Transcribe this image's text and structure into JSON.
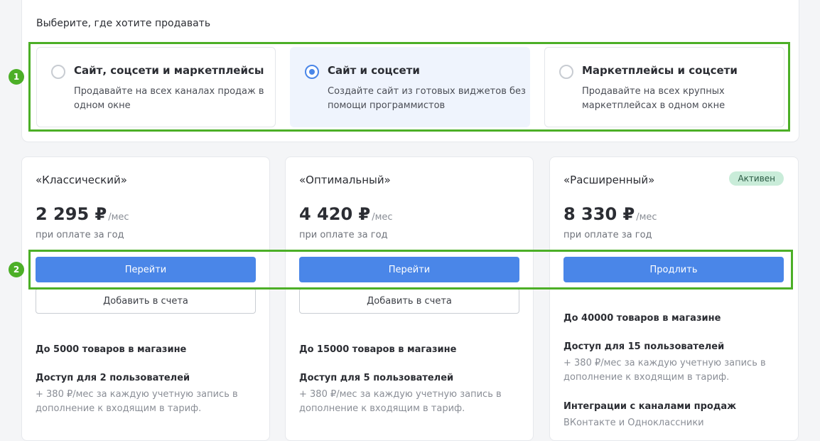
{
  "header": {
    "title": "Выберите, где хотите продавать"
  },
  "channels": [
    {
      "title": "Сайт, соцсети и маркетплейсы",
      "description": "Продавайте на всех каналах продаж в одном окне",
      "selected": false
    },
    {
      "title": "Сайт и соцсети",
      "description": "Создайте сайт из готовых виджетов без помощи программистов",
      "selected": true
    },
    {
      "title": "Маркетплейсы и соцсети",
      "description": "Продавайте на всех крупных маркетплейсах в одном окне",
      "selected": false
    }
  ],
  "plans": [
    {
      "name": "«Классический»",
      "price": "2 295 ₽",
      "unit": "/мес",
      "note": "при оплате за год",
      "primary_label": "Перейти",
      "secondary_label": "Добавить в счета",
      "products": "До 5000 товаров в магазине",
      "users": "Доступ для 2 пользователей",
      "users_note": "+ 380 ₽/мес за каждую учетную запись в дополнение к входящим в тариф."
    },
    {
      "name": "«Оптимальный»",
      "price": "4 420 ₽",
      "unit": "/мес",
      "note": "при оплате за год",
      "primary_label": "Перейти",
      "secondary_label": "Добавить в счета",
      "products": "До 15000 товаров в магазине",
      "users": "Доступ для 5 пользователей",
      "users_note": "+ 380 ₽/мес за каждую учетную запись в дополнение к входящим в тариф."
    },
    {
      "name": "«Расширенный»",
      "badge": "Активен",
      "price": "8 330 ₽",
      "unit": "/мес",
      "note": "при оплате за год",
      "primary_label": "Продлить",
      "products": "До 40000 товаров в магазине",
      "users": "Доступ для 15 пользователей",
      "users_note": "+ 380 ₽/мес за каждую учетную запись в дополнение к входящим в тариф.",
      "integrations": "Интеграции с каналами продаж",
      "integrations_note": "ВКонтакте и Одноклассники"
    }
  ],
  "annotations": {
    "marker1": "1",
    "marker2": "2",
    "color": "#4caf27"
  },
  "colors": {
    "accent": "#4a86e8",
    "selected_bg": "#eff4fd",
    "badge_bg": "#c9ecd9"
  }
}
